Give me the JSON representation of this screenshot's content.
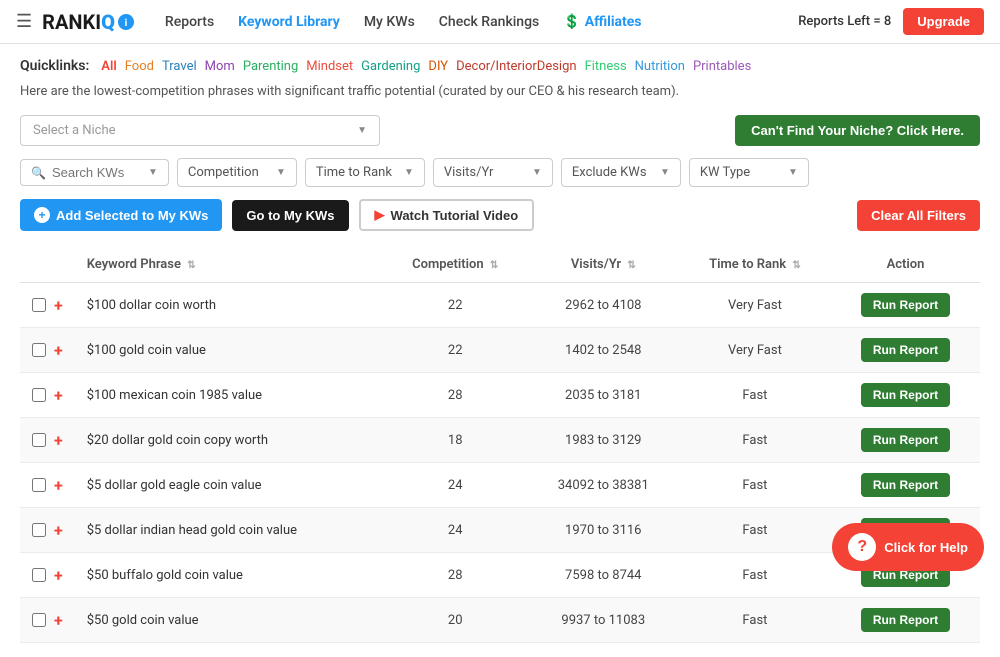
{
  "header": {
    "menu_icon": "☰",
    "logo": "RANKI",
    "logo_iq": "Q",
    "nav": [
      {
        "label": "Reports",
        "href": "#",
        "active": false
      },
      {
        "label": "Keyword Library",
        "href": "#",
        "active": true
      },
      {
        "label": "My KWs",
        "href": "#",
        "active": false
      },
      {
        "label": "Check Rankings",
        "href": "#",
        "active": false
      },
      {
        "label": "Affiliates",
        "href": "#",
        "active": false,
        "icon": "💲"
      }
    ],
    "reports_left": "Reports Left = 8",
    "upgrade_label": "Upgrade"
  },
  "quicklinks": {
    "label": "Quicklinks:",
    "items": [
      {
        "label": "All",
        "class": "ql-all"
      },
      {
        "label": "Food",
        "class": "ql-food"
      },
      {
        "label": "Travel",
        "class": "ql-travel"
      },
      {
        "label": "Mom",
        "class": "ql-mom"
      },
      {
        "label": "Parenting",
        "class": "ql-parenting"
      },
      {
        "label": "Mindset",
        "class": "ql-mindset"
      },
      {
        "label": "Gardening",
        "class": "ql-gardening"
      },
      {
        "label": "DIY",
        "class": "ql-diy"
      },
      {
        "label": "Decor/InteriorDesign",
        "class": "ql-decor"
      },
      {
        "label": "Fitness",
        "class": "ql-fitness"
      },
      {
        "label": "Nutrition",
        "class": "ql-nutrition"
      },
      {
        "label": "Printables",
        "class": "ql-printables"
      }
    ]
  },
  "subtitle": "Here are the lowest-competition phrases with significant traffic potential (curated by our CEO & his research team).",
  "filters": {
    "niche_placeholder": "Select a Niche",
    "cant_find_btn": "Can't Find Your Niche? Click Here.",
    "search_placeholder": "Search KWs",
    "dropdowns": [
      {
        "label": "Competition"
      },
      {
        "label": "Time to Rank"
      },
      {
        "label": "Visits/Yr"
      },
      {
        "label": "Exclude KWs"
      },
      {
        "label": "KW Type"
      }
    ]
  },
  "actions": {
    "add_selected": "Add Selected to My KWs",
    "go_to_kws": "Go to My KWs",
    "watch_tutorial": "Watch Tutorial Video",
    "clear_all": "Clear All Filters"
  },
  "table": {
    "columns": [
      {
        "label": ""
      },
      {
        "label": "Keyword Phrase",
        "sortable": true
      },
      {
        "label": "Competition",
        "sortable": true
      },
      {
        "label": "Visits/Yr",
        "sortable": true
      },
      {
        "label": "Time to Rank",
        "sortable": true
      },
      {
        "label": "Action"
      }
    ],
    "rows": [
      {
        "keyword": "$100 dollar coin worth",
        "competition": 22,
        "visits": "2962 to 4108",
        "time_to_rank": "Very Fast"
      },
      {
        "keyword": "$100 gold coin value",
        "competition": 22,
        "visits": "1402 to 2548",
        "time_to_rank": "Very Fast"
      },
      {
        "keyword": "$100 mexican coin 1985 value",
        "competition": 28,
        "visits": "2035 to 3181",
        "time_to_rank": "Fast"
      },
      {
        "keyword": "$20 dollar gold coin copy worth",
        "competition": 18,
        "visits": "1983 to 3129",
        "time_to_rank": "Fast"
      },
      {
        "keyword": "$5 dollar gold eagle coin value",
        "competition": 24,
        "visits": "34092 to 38381",
        "time_to_rank": "Fast"
      },
      {
        "keyword": "$5 dollar indian head gold coin value",
        "competition": 24,
        "visits": "1970 to 3116",
        "time_to_rank": "Fast"
      },
      {
        "keyword": "$50 buffalo gold coin value",
        "competition": 28,
        "visits": "7598 to 8744",
        "time_to_rank": "Fast"
      },
      {
        "keyword": "$50 gold coin value",
        "competition": 20,
        "visits": "9937 to 11083",
        "time_to_rank": "Fast"
      }
    ],
    "run_report_label": "Run Report"
  },
  "help": {
    "label": "Click for Help"
  }
}
